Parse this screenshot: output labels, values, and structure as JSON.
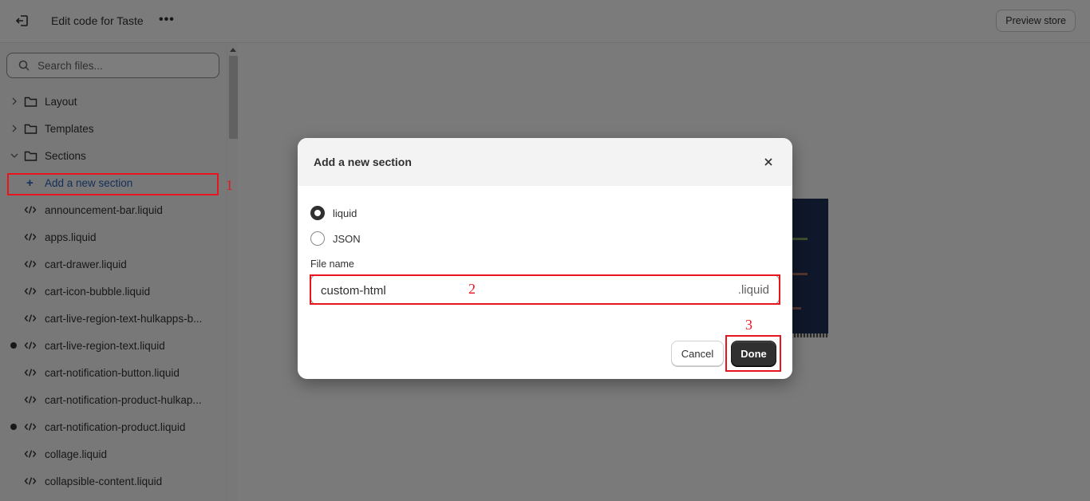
{
  "topbar": {
    "exit_icon": "exit-icon",
    "title": "Edit code for Taste",
    "more_label": "•••",
    "preview_label": "Preview store"
  },
  "sidebar": {
    "search_placeholder": "Search files...",
    "folders": [
      {
        "label": "Layout",
        "expanded": false
      },
      {
        "label": "Templates",
        "expanded": false
      },
      {
        "label": "Sections",
        "expanded": true
      }
    ],
    "add_section_label": "Add a new section",
    "files": [
      {
        "name": "announcement-bar.liquid",
        "modified": false
      },
      {
        "name": "apps.liquid",
        "modified": false
      },
      {
        "name": "cart-drawer.liquid",
        "modified": false
      },
      {
        "name": "cart-icon-bubble.liquid",
        "modified": false
      },
      {
        "name": "cart-live-region-text-hulkapps-b...",
        "modified": false
      },
      {
        "name": "cart-live-region-text.liquid",
        "modified": true
      },
      {
        "name": "cart-notification-button.liquid",
        "modified": false
      },
      {
        "name": "cart-notification-product-hulkap...",
        "modified": false
      },
      {
        "name": "cart-notification-product.liquid",
        "modified": true
      },
      {
        "name": "collage.liquid",
        "modified": false
      },
      {
        "name": "collapsible-content.liquid",
        "modified": false
      }
    ]
  },
  "preview": {
    "line_colors": [
      "#7b9a5a",
      "#a86a5e",
      "#a86a5e"
    ]
  },
  "modal": {
    "title": "Add a new section",
    "options": [
      {
        "label": "liquid",
        "checked": true
      },
      {
        "label": "JSON",
        "checked": false
      }
    ],
    "file_name_label": "File name",
    "file_name_value": "custom-html",
    "file_suffix": ".liquid",
    "cancel_label": "Cancel",
    "done_label": "Done"
  },
  "annotations": {
    "color": "#e8141e",
    "steps": [
      "1",
      "2",
      "3"
    ]
  }
}
